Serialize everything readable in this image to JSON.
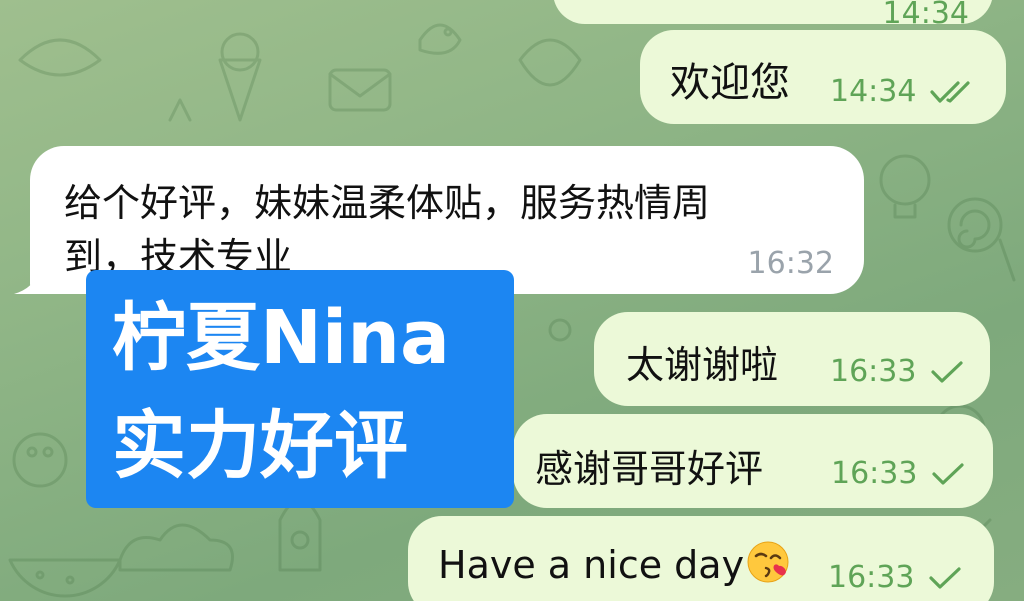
{
  "colors": {
    "outgoing_bubble": "#ecf9d8",
    "incoming_bubble": "#ffffff",
    "outgoing_meta": "#5fa457",
    "incoming_meta": "#9aa3ab",
    "overlay_background": "#1c86f2",
    "overlay_text": "#ffffff"
  },
  "messages": [
    {
      "direction": "outgoing",
      "text": "",
      "time": "14:34",
      "status": "read",
      "clipped": true
    },
    {
      "direction": "outgoing",
      "text": "欢迎您",
      "time": "14:34",
      "status": "read"
    },
    {
      "direction": "incoming",
      "text_line1": "给个好评，妹妹温柔体贴，服务热情周",
      "text_line2": "到，技术专业",
      "time": "16:32"
    },
    {
      "direction": "outgoing",
      "text": "太谢谢啦",
      "time": "16:33",
      "status": "sent"
    },
    {
      "direction": "outgoing",
      "text": "感谢哥哥好评",
      "time": "16:33",
      "status": "sent"
    },
    {
      "direction": "outgoing",
      "text": "Have a nice day",
      "emoji": "face-blowing-kiss-emoji",
      "time": "16:33",
      "status": "sent"
    }
  ],
  "overlay": {
    "line1": "柠夏Nina",
    "line2": "实力好评"
  },
  "wallpaper_icons": [
    "bird-icon",
    "envelope-icon",
    "ice-cream-icon",
    "lightbulb-icon",
    "spiral-candy-icon",
    "rocket-icon",
    "watermelon-icon",
    "cloud-icon"
  ]
}
